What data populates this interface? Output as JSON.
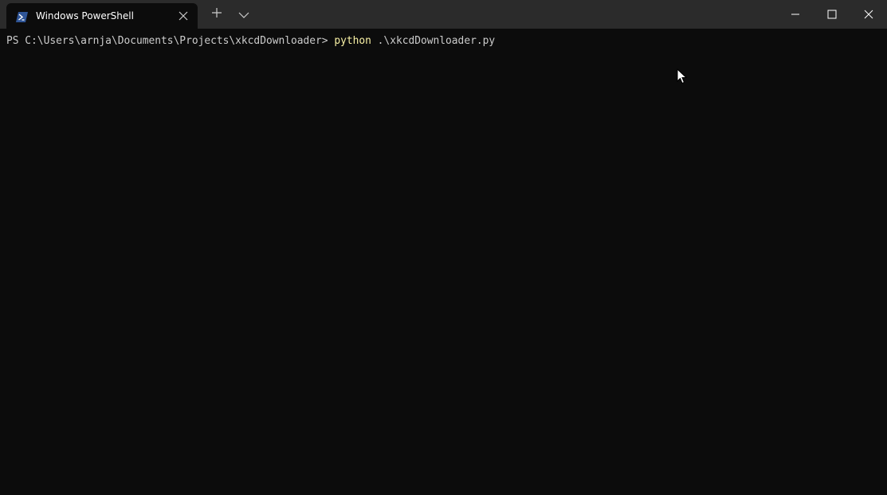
{
  "tab": {
    "title": "Windows PowerShell",
    "icon": "powershell-icon"
  },
  "titlebar_icons": {
    "close_tab": "close-icon",
    "new_tab": "plus-icon",
    "dropdown": "chevron-down-icon",
    "minimize": "minimize-icon",
    "maximize": "maximize-icon",
    "close_window": "close-icon"
  },
  "terminal": {
    "prompt": "PS C:\\Users\\arnja\\Documents\\Projects\\xkcdDownloader> ",
    "command": "python",
    "args": " .\\xkcdDownloader.py"
  },
  "colors": {
    "titlebar": "#2b2b2b",
    "background": "#0c0c0c",
    "text": "#cccccc",
    "command": "#f9f1a5",
    "powershell_blue": "#2f5597"
  }
}
